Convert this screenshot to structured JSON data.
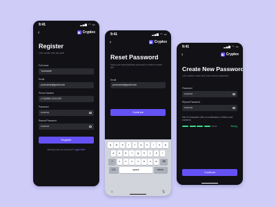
{
  "status": {
    "time": "9:41",
    "icons": "▂▄▆ ◠ ▭"
  },
  "brand": {
    "name": "Cryplex"
  },
  "register": {
    "title": "Register",
    "subtitle": "Let's create new account!",
    "fields": [
      {
        "label": "Full name",
        "value": "Yourname"
      },
      {
        "label": "Email",
        "value": "yourname@gmail.com"
      },
      {
        "label": "Phone Number",
        "value": "(+12)456-1213-232"
      },
      {
        "label": "Password",
        "value": "••••••••••"
      },
      {
        "label": "Repeat Password",
        "value": "••••••••••"
      }
    ],
    "button": "Register",
    "footer_text": "Already have an account?",
    "footer_link": "Login Here"
  },
  "reset": {
    "title": "Reset Password",
    "subtitle": "Input your email address account to receive a reset link",
    "email_label": "Email",
    "email_value": "yourname@gmail.com",
    "button": "Continue",
    "keyboard": {
      "row1": [
        "q",
        "w",
        "e",
        "r",
        "t",
        "y",
        "u",
        "i",
        "o",
        "p"
      ],
      "row2": [
        "a",
        "s",
        "d",
        "f",
        "g",
        "h",
        "j",
        "k",
        "l"
      ],
      "row3": [
        "⇧",
        "z",
        "x",
        "c",
        "v",
        "b",
        "n",
        "m",
        "⌫"
      ],
      "row4": [
        "123",
        "space",
        "return"
      ],
      "emoji": "☺",
      "mic": "🎙"
    }
  },
  "newpass": {
    "title": "Create New Password",
    "subtitle": "Let's create a new and more secure password",
    "password_label": "Password",
    "password_value": "••••••••••",
    "repeat_label": "Repeat Password",
    "repeat_value": "••••••••••",
    "hint": "Min 8 Characters with a combination of letters and numbers",
    "strength": "Strong",
    "strength_level": 0.8,
    "button": "Continue"
  }
}
